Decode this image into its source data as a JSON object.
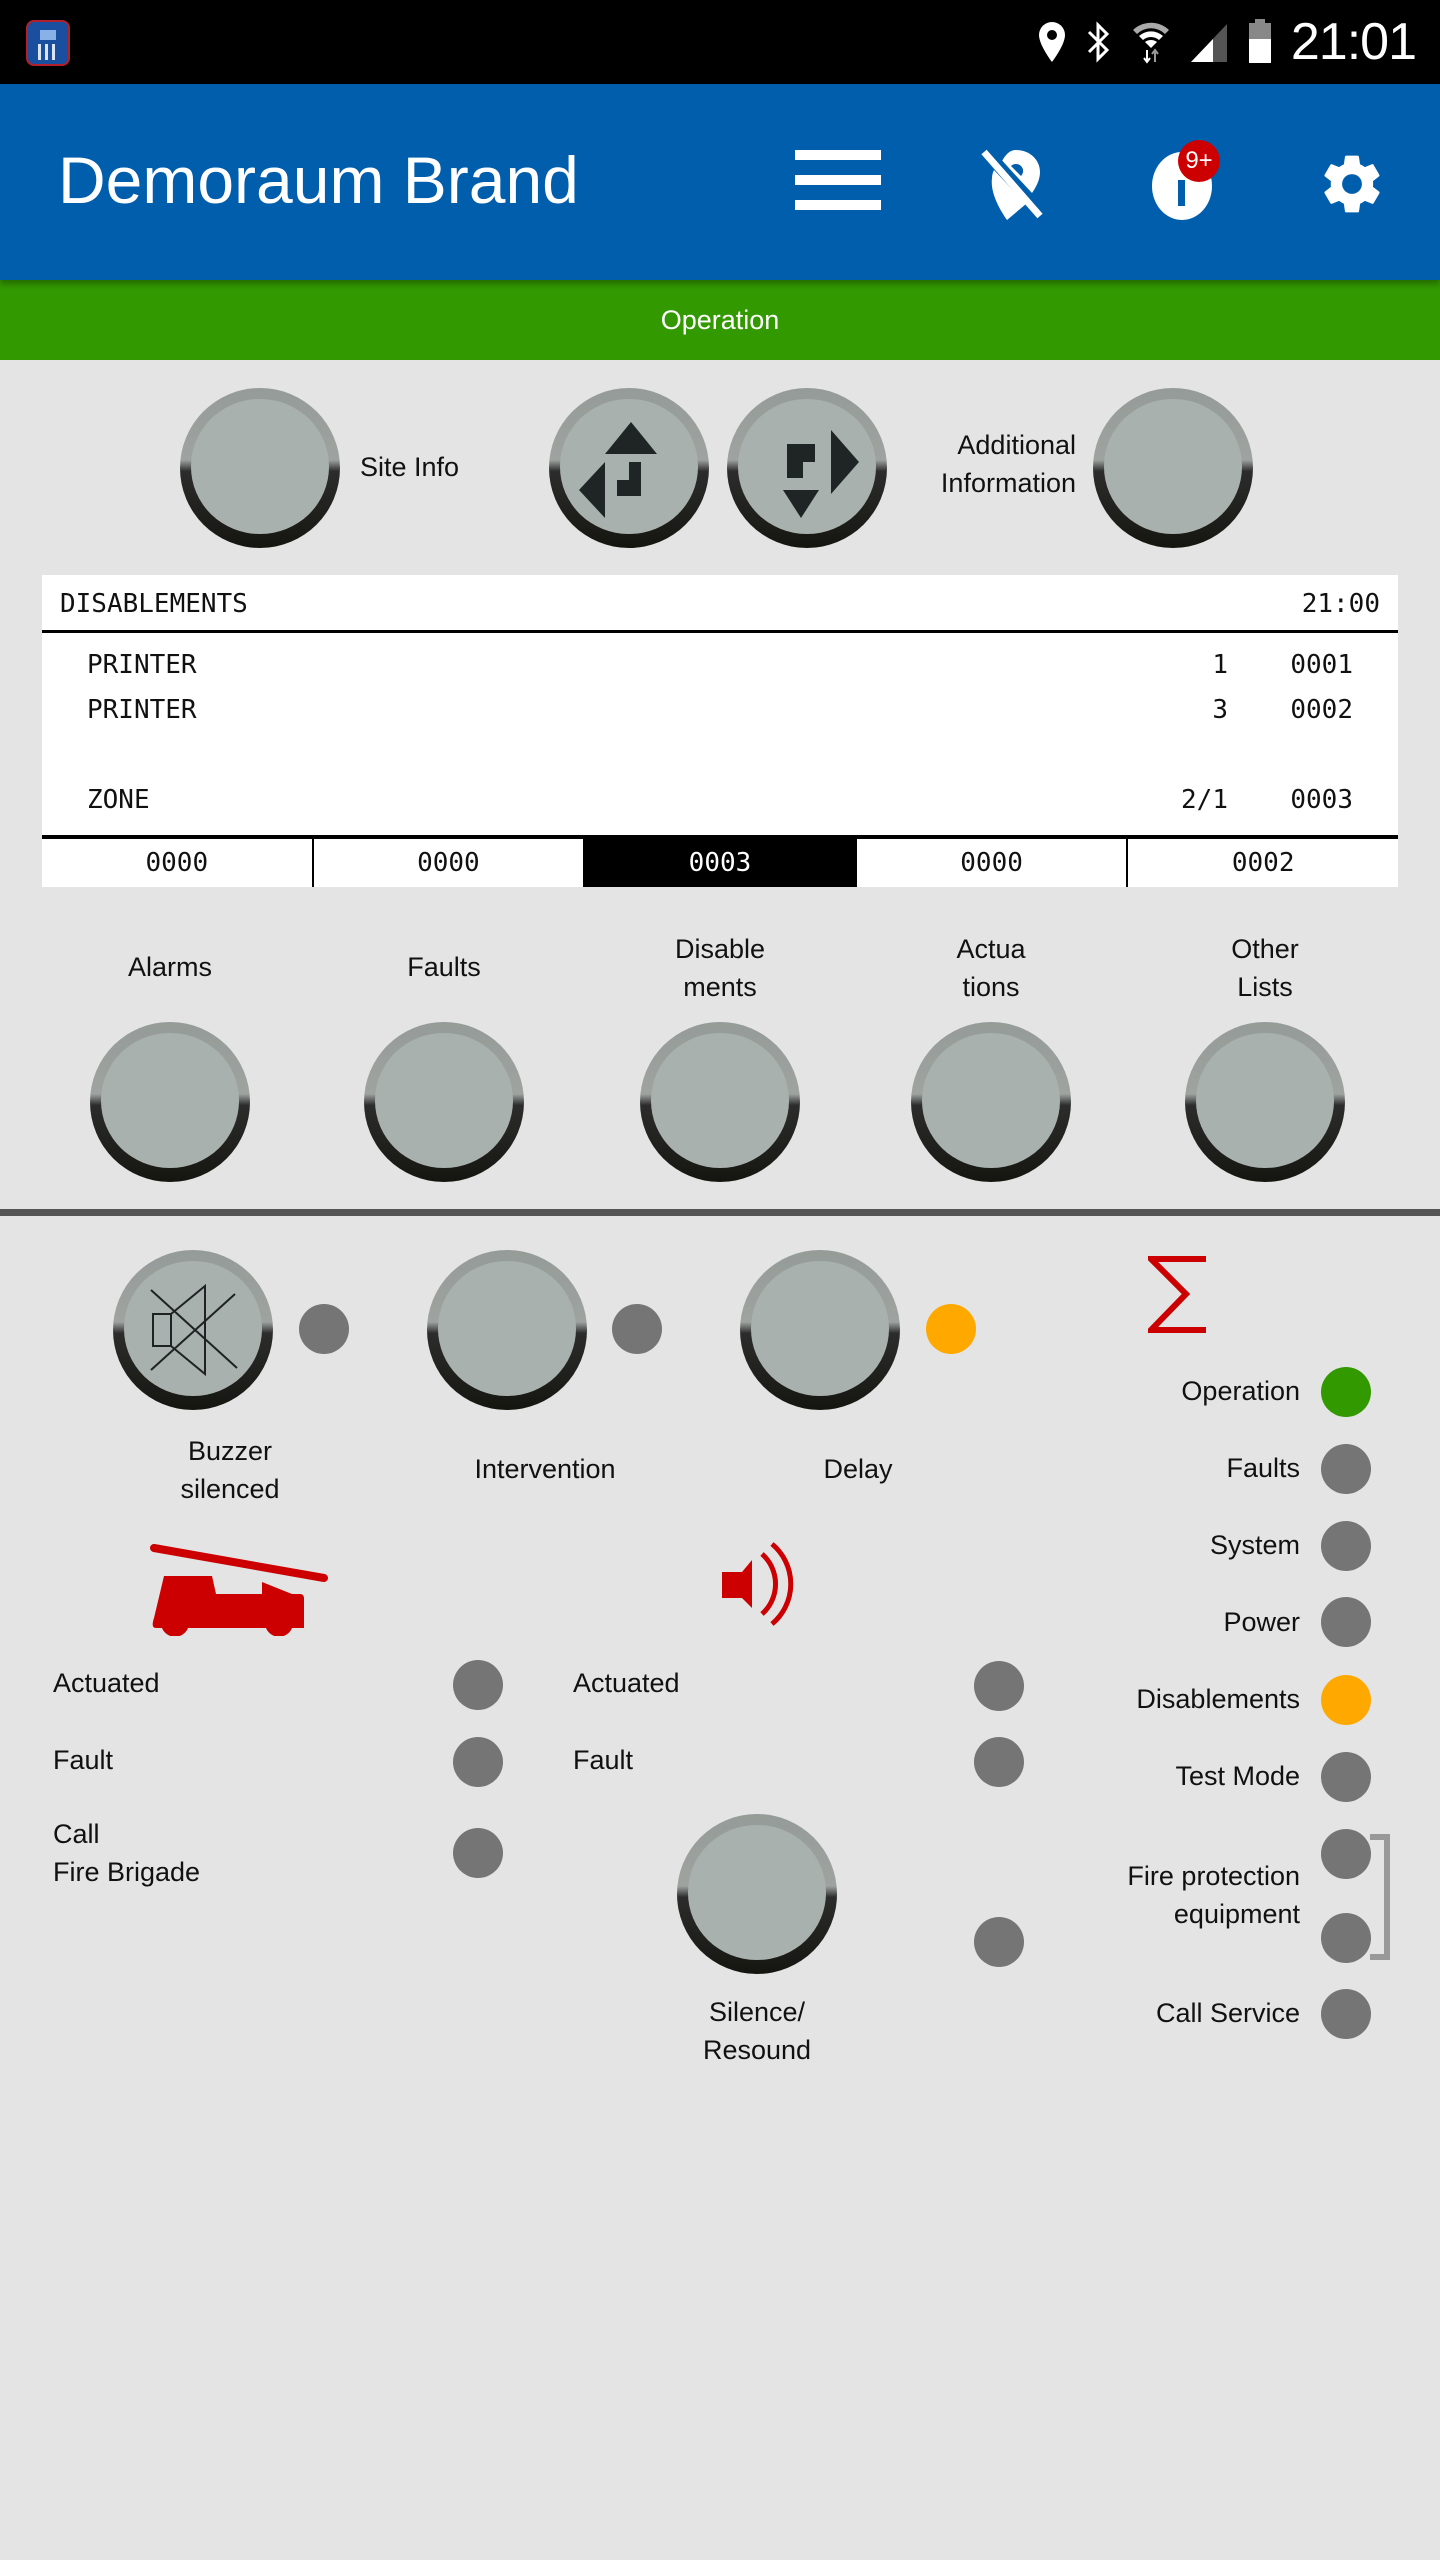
{
  "status_bar": {
    "time": "21:01",
    "icons": [
      "app-calculator-icon",
      "location-icon",
      "bluetooth-icon",
      "wifi-icon",
      "signal-icon",
      "battery-icon"
    ]
  },
  "app_bar": {
    "title": "Demoraum Brand",
    "actions": [
      {
        "name": "menu-icon"
      },
      {
        "name": "location-off-icon"
      },
      {
        "name": "info-icon",
        "badge": "9+"
      },
      {
        "name": "settings-icon"
      }
    ]
  },
  "operation_bar": {
    "label": "Operation",
    "color": "#339900"
  },
  "top_controls": {
    "site_info": "Site Info",
    "additional_info_line1": "Additional",
    "additional_info_line2": "Information"
  },
  "lcd": {
    "title": "DISABLEMENTS",
    "time": "21:00",
    "rows": [
      {
        "name": "PRINTER",
        "num": "1",
        "code": "0001"
      },
      {
        "name": "PRINTER",
        "num": "3",
        "code": "0002"
      },
      {
        "name": "ZONE",
        "num": "2/1",
        "code": "0003"
      }
    ],
    "counters": [
      {
        "value": "0000",
        "active": false
      },
      {
        "value": "0000",
        "active": false
      },
      {
        "value": "0003",
        "active": true
      },
      {
        "value": "0000",
        "active": false
      },
      {
        "value": "0002",
        "active": false
      }
    ]
  },
  "list_buttons": [
    {
      "line1": "Alarms",
      "line2": ""
    },
    {
      "line1": "Faults",
      "line2": ""
    },
    {
      "line1": "Disable",
      "line2": "ments"
    },
    {
      "line1": "Actua",
      "line2": "tions"
    },
    {
      "line1": "Other",
      "line2": "Lists"
    }
  ],
  "function_buttons": {
    "buzzer_line1": "Buzzer",
    "buzzer_line2": "silenced",
    "intervention": "Intervention",
    "delay": "Delay",
    "buzzer_led": "off",
    "intervention_led": "off",
    "delay_led": "amber"
  },
  "fire_brigade": {
    "icon": "fire-truck-icon",
    "items": [
      {
        "label": "Actuated",
        "state": "off"
      },
      {
        "label": "Fault",
        "state": "off"
      },
      {
        "label_line1": "Call",
        "label_line2": "Fire Brigade",
        "state": "off"
      }
    ]
  },
  "sounders": {
    "icon": "speaker-icon",
    "items": [
      {
        "label": "Actuated",
        "state": "off"
      },
      {
        "label": "Fault",
        "state": "off"
      }
    ],
    "silence_line1": "Silence/",
    "silence_line2": "Resound",
    "silence_led": "off"
  },
  "summary": {
    "icon": "sigma-icon",
    "indicators": [
      {
        "label": "Operation",
        "state": "green"
      },
      {
        "label": "Faults",
        "state": "off"
      },
      {
        "label": "System",
        "state": "off"
      },
      {
        "label": "Power",
        "state": "off"
      },
      {
        "label": "Disablements",
        "state": "amber"
      },
      {
        "label": "Test Mode",
        "state": "off"
      }
    ],
    "fire_protection_line1": "Fire protection",
    "fire_protection_line2": "equipment",
    "fire_protection_leds": [
      "off",
      "off"
    ],
    "call_service": "Call Service",
    "call_service_state": "off"
  },
  "colors": {
    "brand_blue": "#005eac",
    "operation_green": "#339900",
    "amber": "#ffa800",
    "led_off": "#757575",
    "alarm_red": "#cc0000"
  }
}
